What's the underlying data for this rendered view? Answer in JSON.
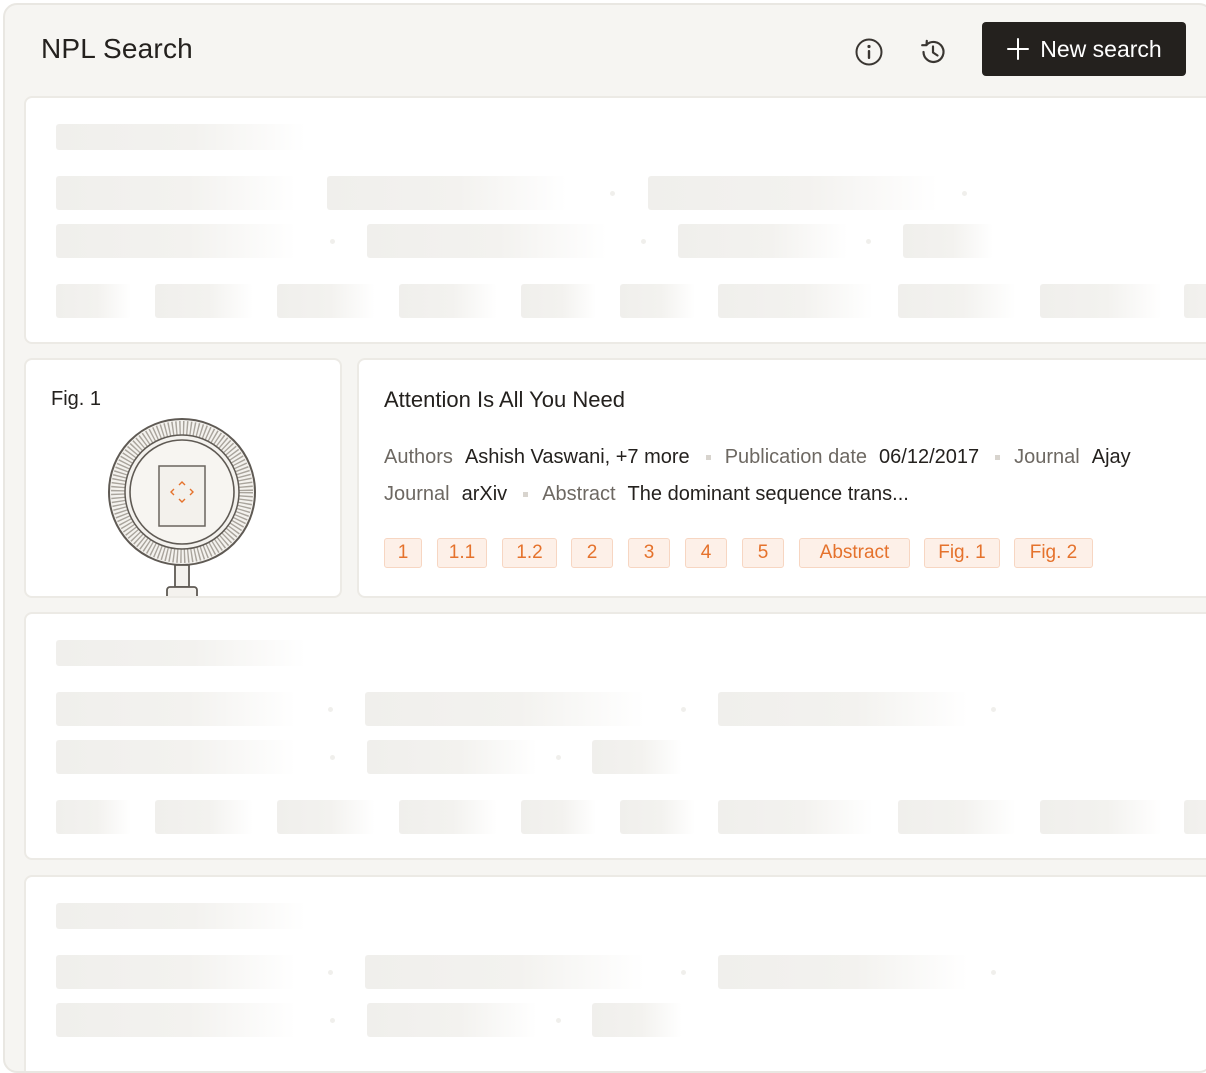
{
  "header": {
    "title": "NPL Search",
    "new_search_label": "New search"
  },
  "result": {
    "figure_label": "Fig. 1",
    "title": "Attention Is All You Need",
    "row1": [
      {
        "key": "Authors",
        "value": "Ashish Vaswani,  +7 more"
      },
      {
        "key": "Publication date",
        "value": "06/12/2017"
      },
      {
        "key": "Journal",
        "value": "Ajay"
      }
    ],
    "row2": [
      {
        "key": "Journal",
        "value": "arXiv"
      },
      {
        "key": "Abstract",
        "value": "The dominant sequence trans..."
      }
    ],
    "tags": [
      "1",
      "1.1",
      "1.2",
      "2",
      "3",
      "4",
      "5",
      "Abstract",
      "Fig. 1",
      "Fig. 2"
    ]
  },
  "colors": {
    "accent": "#e5722c",
    "button_bg": "#24211e",
    "tag_bg": "#fdf0e8"
  }
}
